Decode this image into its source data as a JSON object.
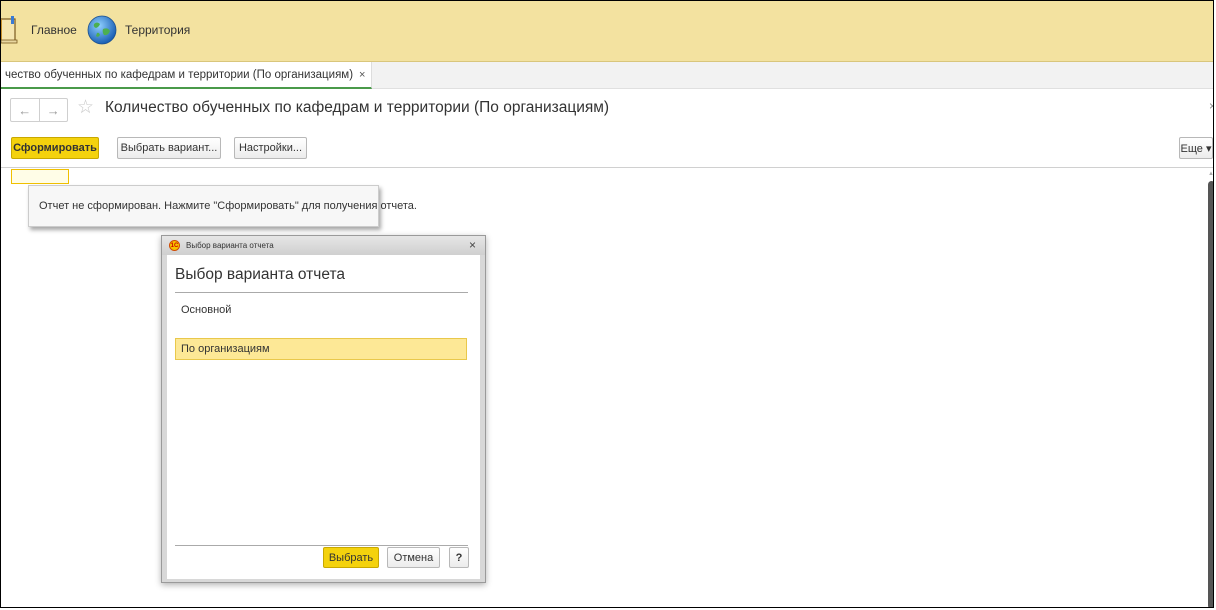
{
  "sections": [
    {
      "label": "Главное",
      "icon": "book-icon"
    },
    {
      "label": "Территория",
      "icon": "globe-icon"
    }
  ],
  "open_tab": {
    "label": "чество обученных по кафедрам и территории (По организациям)",
    "close": "×"
  },
  "header": {
    "back": "←",
    "forward": "→",
    "star": "☆",
    "title": "Количество обученных по кафедрам и территории (По организациям)",
    "close": "×"
  },
  "toolbar": {
    "generate": "Сформировать",
    "choose_variant": "Выбрать вариант...",
    "settings": "Настройки...",
    "more": "Еще ▾"
  },
  "report": {
    "message": "Отчет не сформирован. Нажмите \"Сформировать\" для получения отчета."
  },
  "dialog": {
    "window_title": "Выбор варианта отчета",
    "close": "×",
    "heading": "Выбор варианта отчета",
    "variants": [
      "Основной",
      "По организациям"
    ],
    "selected_index": 1,
    "select_btn": "Выбрать",
    "cancel_btn": "Отмена",
    "help_btn": "?"
  },
  "colors": {
    "section_bar": "#f3e2a0",
    "primary_button": "#f4d20d",
    "selected_row": "#fde896",
    "active_tab_underline": "#4a9a4a"
  }
}
